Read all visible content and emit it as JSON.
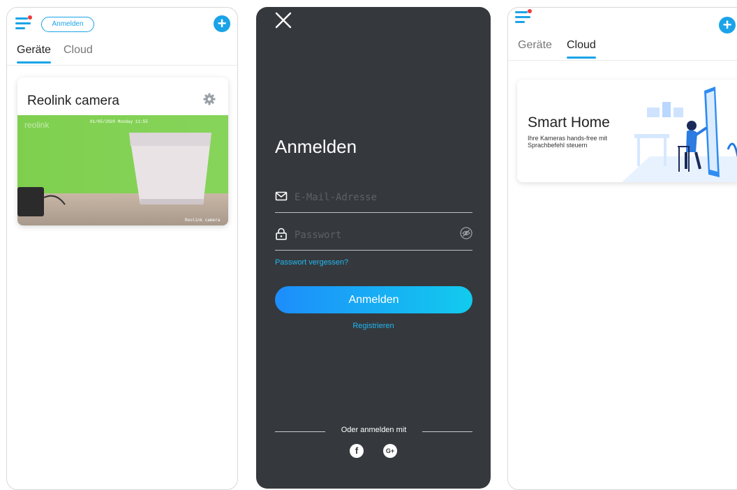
{
  "screen1": {
    "login_button": "Anmelden",
    "tabs": [
      {
        "label": "Geräte",
        "active": true
      },
      {
        "label": "Cloud",
        "active": false
      }
    ],
    "camera_card": {
      "title": "Reolink camera",
      "watermark": "reolink",
      "osd_timestamp": "01/05/2020 Monday 11:55",
      "osd_name": "Reolink camera"
    }
  },
  "screen2": {
    "title": "Anmelden",
    "email_placeholder": "E-Mail-Adresse",
    "password_placeholder": "Passwort",
    "forgot_password": "Passwort vergessen?",
    "login_button": "Anmelden",
    "register": "Registrieren",
    "or_login_with": "Oder anmelden mit",
    "social": [
      "facebook",
      "google-plus"
    ],
    "social_labels": {
      "facebook": "f",
      "google": "G+"
    }
  },
  "screen3": {
    "tabs": [
      {
        "label": "Geräte",
        "active": false
      },
      {
        "label": "Cloud",
        "active": true
      }
    ],
    "smart_home": {
      "title": "Smart Home",
      "subtitle": "Ihre Kameras hands-free mit Sprachbefehl steuern"
    }
  },
  "colors": {
    "accent": "#1aa3e8",
    "login_bg": "#35393d",
    "link": "#21b7f2",
    "gradient_start": "#1d8dfb",
    "gradient_end": "#12cbee",
    "notification_dot": "#ee3b3b"
  }
}
